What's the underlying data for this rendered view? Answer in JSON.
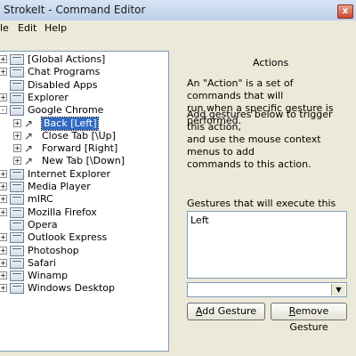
{
  "window": {
    "title": "StrokeIt - Command Editor",
    "close_glyph": "x"
  },
  "menu": {
    "file": "le",
    "edit": "Edit",
    "help": "Help"
  },
  "tree": [
    {
      "label": "[Global Actions]",
      "level": 0,
      "icon": "folder-icon",
      "expander": "+"
    },
    {
      "label": "Chat Programs",
      "level": 0,
      "icon": "folder-icon",
      "expander": "+"
    },
    {
      "label": "Disabled Apps",
      "level": 0,
      "icon": "folder-icon",
      "expander": ""
    },
    {
      "label": "Explorer",
      "level": 0,
      "icon": "folder-icon",
      "expander": "+"
    },
    {
      "label": "Google Chrome",
      "level": 0,
      "icon": "folder-icon",
      "expander": "-"
    },
    {
      "label": "Back [Left]",
      "level": 1,
      "icon": "gesture-icon",
      "expander": "+",
      "selected": true
    },
    {
      "label": "Close Tab [\\Up]",
      "level": 1,
      "icon": "gesture-icon",
      "expander": "+"
    },
    {
      "label": "Forward [Right]",
      "level": 1,
      "icon": "gesture-icon",
      "expander": "+"
    },
    {
      "label": "New Tab [\\Down]",
      "level": 1,
      "icon": "gesture-icon",
      "expander": "+"
    },
    {
      "label": "Internet Explorer",
      "level": 0,
      "icon": "folder-icon",
      "expander": "+"
    },
    {
      "label": "Media Player",
      "level": 0,
      "icon": "folder-icon",
      "expander": "+"
    },
    {
      "label": "mIRC",
      "level": 0,
      "icon": "folder-icon",
      "expander": "+"
    },
    {
      "label": "Mozilla Firefox",
      "level": 0,
      "icon": "folder-icon",
      "expander": "+"
    },
    {
      "label": "Opera",
      "level": 0,
      "icon": "folder-icon",
      "expander": ""
    },
    {
      "label": "Outlook Express",
      "level": 0,
      "icon": "folder-icon",
      "expander": "+"
    },
    {
      "label": "Photoshop",
      "level": 0,
      "icon": "folder-icon",
      "expander": "+"
    },
    {
      "label": "Safari",
      "level": 0,
      "icon": "folder-icon",
      "expander": "+"
    },
    {
      "label": "Winamp",
      "level": 0,
      "icon": "folder-icon",
      "expander": "+"
    },
    {
      "label": "Windows Desktop",
      "level": 0,
      "icon": "folder-icon",
      "expander": "+"
    }
  ],
  "panel": {
    "title": "Actions",
    "desc1": [
      "An \"Action\" is a set of commands that will",
      "run when a specific gesture is performed."
    ],
    "desc2": [
      "Add gestures below to trigger this action,",
      "and use the mouse context menus to add",
      "commands to this action."
    ],
    "gestures_label": "Gestures that will execute this action:",
    "gestures": [
      "Left"
    ],
    "combo_value": "",
    "add_gesture": {
      "mnemonic": "A",
      "rest": "dd Gesture"
    },
    "remove_gesture": {
      "pre": "",
      "mnemonic": "R",
      "rest": "emove Gesture"
    }
  }
}
